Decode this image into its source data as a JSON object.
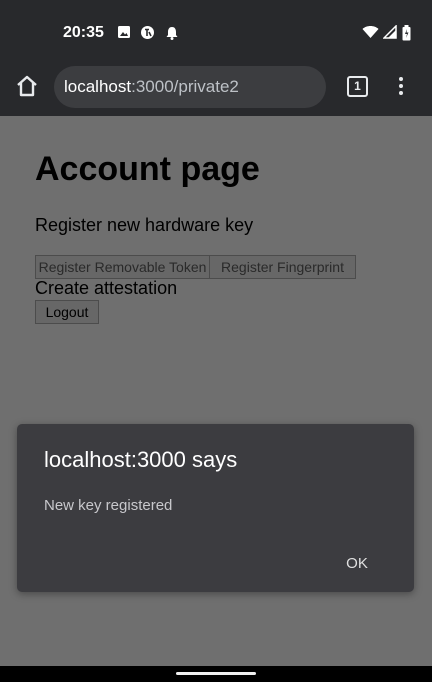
{
  "status_bar": {
    "time": "20:35",
    "icons_left": [
      "image-icon",
      "translate-icon",
      "notification-bell-icon"
    ],
    "icons_right": [
      "wifi-icon",
      "cell-signal-icon",
      "battery-icon"
    ]
  },
  "browser": {
    "url_host": "localhost",
    "url_path": ":3000/private2",
    "tab_count": "1",
    "icons": [
      "home-icon",
      "tab-switcher-icon",
      "overflow-menu-icon"
    ]
  },
  "page": {
    "title": "Account page",
    "subtitle": "Register new hardware key",
    "register_removable_label": "Register Removable Token",
    "register_fingerprint_label": "Register Fingerprint",
    "attestation_text": "Create attestation",
    "logout_label": "Logout"
  },
  "dialog": {
    "title": "localhost:3000 says",
    "message": "New key registered",
    "ok_label": "OK"
  },
  "colors": {
    "chrome_bg": "#28292c",
    "omnibox_bg": "#3c3d40",
    "dialog_bg": "#3c3c40",
    "scrim": "#6f6f6f"
  }
}
